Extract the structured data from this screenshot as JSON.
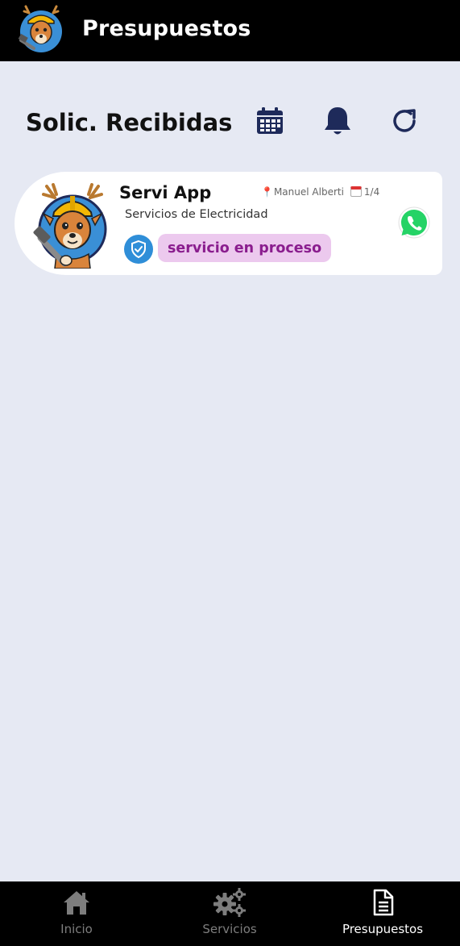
{
  "app_bar": {
    "title": "Presupuestos",
    "logo_icon": "deer-mascot-logo"
  },
  "section": {
    "title": "Solic. Recibidas",
    "actions": [
      {
        "icon": "calendar-icon"
      },
      {
        "icon": "bell-icon"
      },
      {
        "icon": "refresh-icon"
      }
    ]
  },
  "requests": [
    {
      "name": "Servi App",
      "location": "Manuel Alberti",
      "date": "1/4",
      "category": "Servicios de Electricidad",
      "status": "servicio en proceso",
      "verified_icon": "shield-check-icon",
      "contact_icon": "whatsapp-icon"
    }
  ],
  "bottom_nav": {
    "items": [
      {
        "label": "Inicio",
        "icon": "home-icon",
        "active": false
      },
      {
        "label": "Servicios",
        "icon": "gears-icon",
        "active": false
      },
      {
        "label": "Presupuestos",
        "icon": "document-icon",
        "active": true
      }
    ]
  },
  "colors": {
    "background": "#e6e9f3",
    "bar": "#000000",
    "icon_navy": "#1e2a5a",
    "status_bg": "#ecc9ee",
    "status_text": "#8a1d8e",
    "verified_blue": "#2f8ed8",
    "whatsapp_green": "#25d366"
  }
}
